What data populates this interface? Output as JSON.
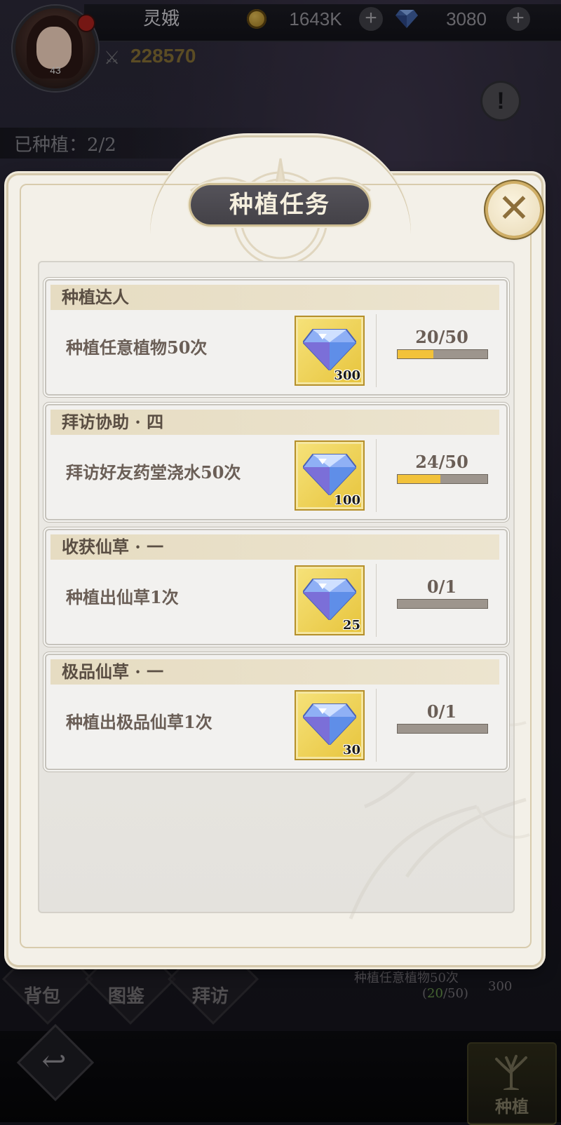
{
  "header": {
    "player_name": "灵娥",
    "level": "43",
    "gold": "1643K",
    "gems": "3080",
    "combat_power": "228570",
    "planted_label": "已种植：2/2"
  },
  "dialog": {
    "title": "种植任务",
    "close_symbol": "✕",
    "tasks": [
      {
        "title": "种植达人",
        "description": "种植任意植物50次",
        "reward_qty": "300",
        "progress_text": "20/50",
        "progress": 0.4
      },
      {
        "title": "拜访协助 · 四",
        "description": "拜访好友药堂浇水50次",
        "reward_qty": "100",
        "progress_text": "24/50",
        "progress": 0.48
      },
      {
        "title": "收获仙草 · 一",
        "description": "种植出仙草1次",
        "reward_qty": "25",
        "progress_text": "0/1",
        "progress": 0
      },
      {
        "title": "极品仙草 · 一",
        "description": "种植出极品仙草1次",
        "reward_qty": "30",
        "progress_text": "0/1",
        "progress": 0
      }
    ]
  },
  "bottom_nav": {
    "bag": "背包",
    "atlas": "图鉴",
    "visit": "拜访",
    "plant": "种植",
    "side_task": "种植任意植物50次",
    "side_open": "(",
    "side_current": "20",
    "side_rest": "/50)",
    "side_reward": "300"
  },
  "colors": {
    "accent_gold": "#f2c23a",
    "title_plate": "#4c4a50",
    "reward_bg": "#efd358"
  },
  "icons": [
    "coin-icon",
    "gem-icon",
    "plus-icon",
    "crossed-swords-icon",
    "info-icon",
    "close-icon",
    "back-arrow-icon",
    "tree-icon"
  ]
}
